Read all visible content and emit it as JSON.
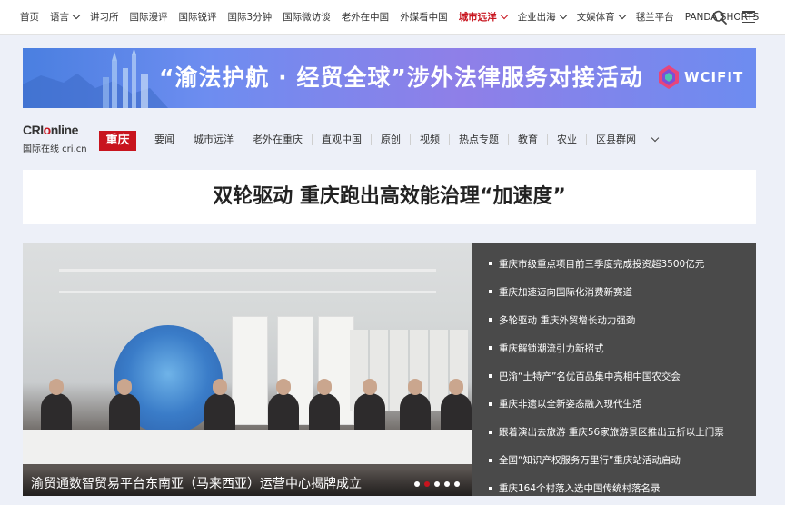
{
  "topnav": {
    "items": [
      {
        "label": "首页",
        "dropdown": false,
        "active": false
      },
      {
        "label": "语言",
        "dropdown": true,
        "active": false
      },
      {
        "label": "讲习所",
        "dropdown": false,
        "active": false
      },
      {
        "label": "国际漫评",
        "dropdown": false,
        "active": false
      },
      {
        "label": "国际锐评",
        "dropdown": false,
        "active": false
      },
      {
        "label": "国际3分钟",
        "dropdown": false,
        "active": false
      },
      {
        "label": "国际微访谈",
        "dropdown": false,
        "active": false
      },
      {
        "label": "老外在中国",
        "dropdown": false,
        "active": false
      },
      {
        "label": "外媒看中国",
        "dropdown": false,
        "active": false
      },
      {
        "label": "城市远洋",
        "dropdown": true,
        "active": true
      },
      {
        "label": "企业出海",
        "dropdown": true,
        "active": false
      },
      {
        "label": "文娱体育",
        "dropdown": true,
        "active": false
      },
      {
        "label": "毬兰平台",
        "dropdown": false,
        "active": false
      },
      {
        "label": "PANDA SHORTS",
        "dropdown": false,
        "active": false
      }
    ],
    "icons": {
      "search": "search-icon",
      "menu": "hamburger-menu-icon"
    }
  },
  "banner": {
    "title": "“渝法护航 · 经贸全球”涉外法律服务对接活动",
    "logo_text": "WCIFIT"
  },
  "brand": {
    "logo_main_a": "CRI",
    "logo_main_b": "o",
    "logo_main_c": "nline",
    "logo_sub": "国际在线 cri.cn",
    "city": "重庆"
  },
  "channel_nav": {
    "items": [
      "要闻",
      "城市远洋",
      "老外在重庆",
      "直观中国",
      "原创",
      "视频",
      "热点专题",
      "教育",
      "农业",
      "区县群网"
    ]
  },
  "headline": "双轮驱动 重庆跑出高效能治理“加速度”",
  "carousel": {
    "caption": "渝贸通数智贸易平台东南亚（马来西亚）运营中心揭牌成立",
    "slide_count": 5,
    "active_index": 1
  },
  "news_list": [
    "重庆市级重点项目前三季度完成投资超3500亿元",
    "重庆加速迈向国际化消费新赛道",
    "多轮驱动 重庆外贸增长动力强劲",
    "重庆解锁潮流引力新招式",
    "巴渝“土特产”名优百品集中亮相中国农交会",
    "重庆非遗以全新姿态融入现代生活",
    "跟着演出去旅游 重庆56家旅游景区推出五折以上门票",
    "全国“知识产权服务万里行”重庆站活动启动",
    "重庆164个村落入选中国传统村落名录"
  ],
  "colors": {
    "accent": "#c8141e",
    "list_bg": "#4a4a4a",
    "page_bg": "#edf0f8"
  }
}
